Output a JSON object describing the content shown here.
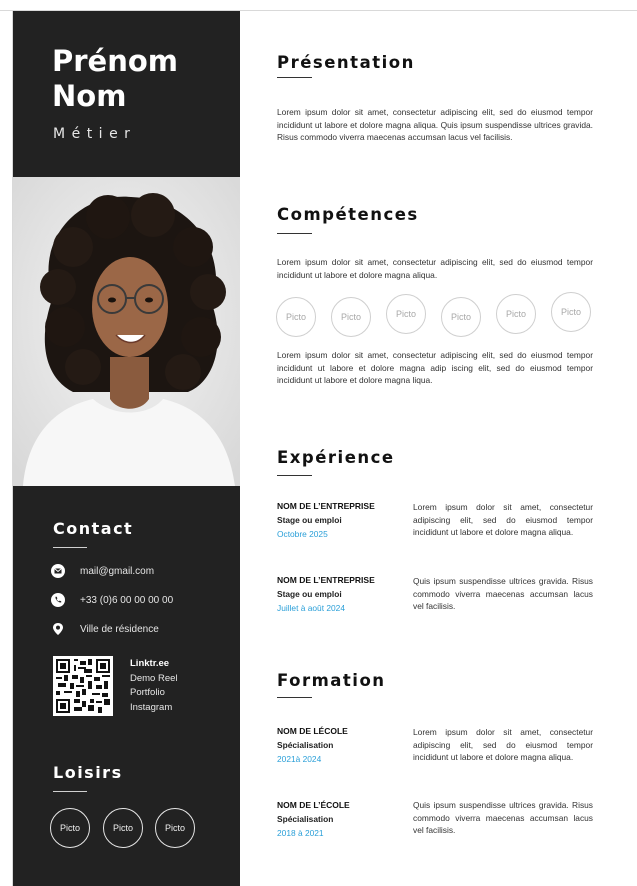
{
  "identity": {
    "first_name": "Prénom",
    "last_name": "Nom",
    "job_title": "Métier"
  },
  "contact": {
    "title": "Contact",
    "items": [
      {
        "icon": "mail-icon",
        "text": "mail@gmail.com"
      },
      {
        "icon": "phone-icon",
        "text": "+33 (0)6 00 00 00 00"
      },
      {
        "icon": "location-pin-icon",
        "text": "Ville de résidence"
      }
    ],
    "links": {
      "title": "Linktr.ee",
      "items": [
        "Demo Reel",
        "Portfolio",
        "Instagram"
      ]
    }
  },
  "hobbies": {
    "title": "Loisirs",
    "pictos": [
      "Picto",
      "Picto",
      "Picto"
    ]
  },
  "presentation": {
    "title": "Présentation",
    "text": "Lorem ipsum dolor sit amet, consectetur adipiscing elit, sed do eiusmod tempor incididunt ut labore et dolore magna aliqua. Quis ipsum suspendisse ultrices gravida. Risus commodo viverra maecenas accumsan lacus vel facilisis."
  },
  "skills": {
    "title": "Compétences",
    "text_1": "Lorem ipsum dolor sit amet, consectetur adipiscing elit, sed do eiusmod tempor incididunt ut labore et dolore magna aliqua.",
    "pictos": [
      "Picto",
      "Picto",
      "Picto",
      "Picto",
      "Picto",
      "Picto"
    ],
    "text_2": "Lorem ipsum dolor sit amet, consectetur adipiscing elit, sed do eiusmod tempor incididunt ut labore et dolore magna adip iscing elit, sed do eiusmod tempor incididunt ut labore et dolore magna liqua."
  },
  "experience": {
    "title": "Expérience",
    "entries": [
      {
        "company": "NOM DE L’ENTREPRISE",
        "role": "Stage ou emploi",
        "date": "Octobre 2025",
        "text": "Lorem ipsum dolor sit amet, consectetur adipiscing elit, sed do eiusmod tempor incididunt ut labore et dolore magna aliqua."
      },
      {
        "company": "NOM DE L’ENTREPRISE",
        "role": "Stage ou emploi",
        "date": "Juillet à août 2024",
        "text": "Quis ipsum suspendisse ultrices gravida. Risus commodo viverra maecenas accumsan lacus vel facilisis."
      }
    ]
  },
  "education": {
    "title": "Formation",
    "entries": [
      {
        "school": "NOM DE LÉCOLE",
        "field": "Spécialisation",
        "date": "2021à 2024",
        "text": "Lorem ipsum dolor sit amet, consectetur adipiscing elit, sed do eiusmod tempor incididunt ut labore et dolore magna aliqua."
      },
      {
        "school": "NOM DE L’ÉCOLE",
        "field": "Spécialisation",
        "date": "2018 à 2021",
        "text": "Quis ipsum suspendisse ultrices gravida. Risus commodo viverra maecenas accumsan lacus vel facilisis."
      }
    ]
  },
  "colors": {
    "sidebar": "#222222",
    "accent_date": "#2a9fd8",
    "page": "#ffffff"
  }
}
